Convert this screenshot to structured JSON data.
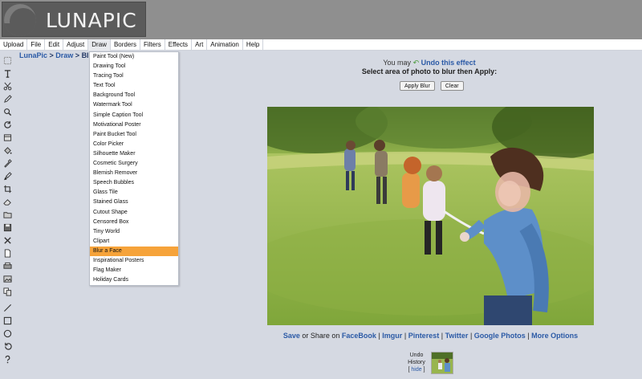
{
  "header": {
    "logo_text": "LUNAPIC"
  },
  "menu": [
    "Upload",
    "File",
    "Edit",
    "Adjust",
    "Draw",
    "Borders",
    "Filters",
    "Effects",
    "Art",
    "Animation",
    "Help"
  ],
  "breadcrumb": {
    "home": "LunaPic",
    "sep": " > ",
    "section": "Draw",
    "current": "Blur"
  },
  "dropdown": {
    "items": [
      "Paint Tool (New)",
      "Drawing Tool",
      "Tracing Tool",
      "Text Tool",
      "Background Tool",
      "Watermark Tool",
      "Simple Caption Tool",
      "Motivational Poster",
      "Paint Bucket Tool",
      "Color Picker",
      "Silhouette Maker",
      "Cosmetic Surgery",
      "Blemish Remover",
      "Speech Bubbles",
      "Glass Tile",
      "Stained Glass",
      "Cutout Shape",
      "Censored Box",
      "Tiny World",
      "Clipart",
      "Blur a Face",
      "Inspirational Posters",
      "Flag Maker",
      "Holiday Cards"
    ],
    "selected": "Blur a Face"
  },
  "prompt": {
    "you_may": "You may",
    "undo_link": "Undo this effect",
    "instruction": "Select area of photo to blur then Apply:"
  },
  "buttons": {
    "apply": "Apply Blur",
    "clear": "Clear"
  },
  "share": {
    "save": "Save",
    "or_share_on": "or Share on",
    "sep": "|",
    "links": [
      "FaceBook",
      "Imgur",
      "Pinterest",
      "Twitter",
      "Google Photos",
      "More Options"
    ]
  },
  "undo_history": {
    "line1": "Undo",
    "line2": "History",
    "open": "[",
    "hide": "hide",
    "close": "]"
  },
  "toolbar_icons": [
    "select-icon",
    "text-icon",
    "scissors-icon",
    "pencil-icon",
    "zoom-icon",
    "rotate-icon",
    "layers-icon",
    "paint-bucket-icon",
    "eyedropper-icon",
    "brush-icon",
    "crop-icon",
    "eraser-icon",
    "open-icon",
    "save-icon",
    "delete-icon",
    "new-page-icon",
    "print-icon",
    "photo-icon",
    "copy-icon",
    "line-icon",
    "rectangle-icon",
    "circle-icon",
    "undo-icon",
    "help-icon"
  ],
  "colors": {
    "header": "#8f8f8f",
    "background": "#d5d9e2",
    "link": "#2b5aa6",
    "selected": "#f6a33a"
  }
}
